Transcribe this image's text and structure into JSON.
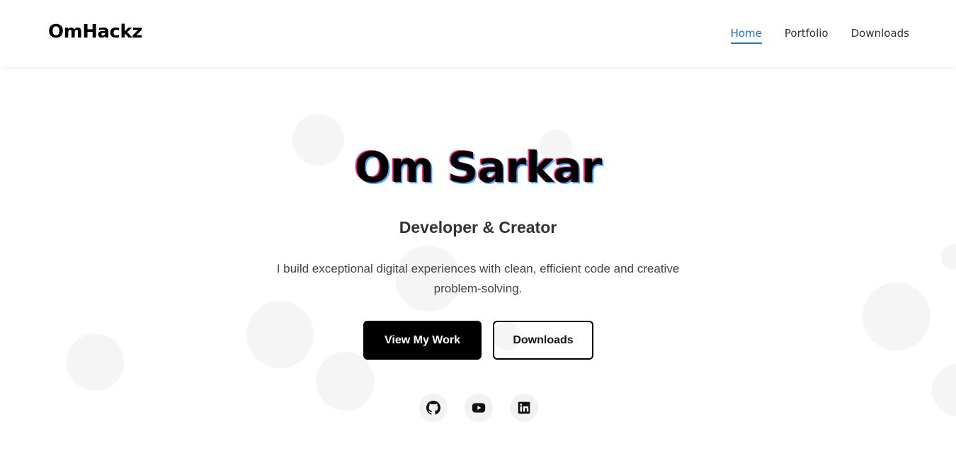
{
  "brand": {
    "logo": "OmHackz"
  },
  "nav": {
    "items": [
      {
        "label": "Home",
        "active": true
      },
      {
        "label": "Portfolio",
        "active": false
      },
      {
        "label": "Downloads",
        "active": false
      }
    ]
  },
  "hero": {
    "name": "Om Sarkar",
    "subtitle": "Developer & Creator",
    "description": "I build exceptional digital experiences with clean, efficient code and creative problem-solving.",
    "primary_button": "View My Work",
    "secondary_button": "Downloads"
  },
  "socials": [
    {
      "icon": "github-icon"
    },
    {
      "icon": "youtube-icon"
    },
    {
      "icon": "linkedin-icon"
    }
  ],
  "colors": {
    "accent": "#1a73e8",
    "text_shadow_blue": "#4fa3ff",
    "text_shadow_pink": "#ff2f8a",
    "button_dark": "#000000"
  }
}
